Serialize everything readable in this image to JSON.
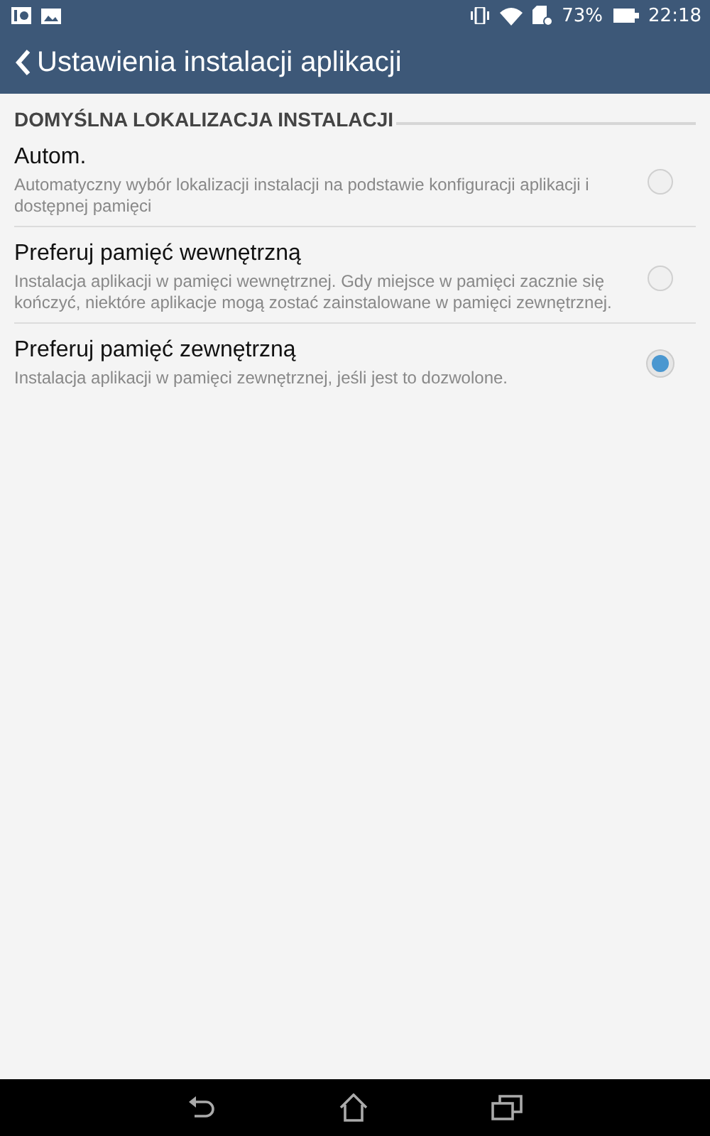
{
  "status_bar": {
    "battery_percent": "73%",
    "time": "22:18"
  },
  "app_bar": {
    "title": "Ustawienia instalacji aplikacji"
  },
  "section": {
    "title": "DOMYŚLNA LOKALIZACJA INSTALACJI"
  },
  "options": [
    {
      "title": "Autom.",
      "description": "Automatyczny wybór lokalizacji instalacji na podstawie konfiguracji aplikacji i dostępnej pamięci",
      "selected": false
    },
    {
      "title": "Preferuj pamięć wewnętrzną",
      "description": "Instalacja aplikacji w pamięci wewnętrznej. Gdy miejsce w pamięci zacznie się kończyć, niektóre aplikacje mogą zostać zainstalowane w pamięci zewnętrznej.",
      "selected": false
    },
    {
      "title": "Preferuj pamięć zewnętrzną",
      "description": "Instalacja aplikacji w pamięci zewnętrznej, jeśli jest to dozwolone.",
      "selected": true
    }
  ]
}
